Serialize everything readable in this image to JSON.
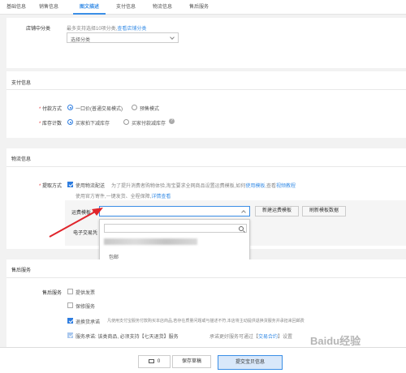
{
  "tabs": [
    {
      "label": "基础信息",
      "active": false
    },
    {
      "label": "销售信息",
      "active": false
    },
    {
      "label": "图文描述",
      "active": true
    },
    {
      "label": "支付信息",
      "active": false
    },
    {
      "label": "物流信息",
      "active": false
    },
    {
      "label": "售后服务",
      "active": false
    }
  ],
  "shop_category": {
    "label": "店铺中分类",
    "hint": "最多支持选择10项分类,",
    "link": "查看店铺分类",
    "select_value": "选择分类"
  },
  "payment": {
    "title": "支付信息",
    "method_label": "付款方式",
    "method_options": [
      "一口价(普通交易模式)",
      "预售模式"
    ],
    "stock_label": "库存计数",
    "stock_options": [
      "买家拍下减库存",
      "买家付款减库存"
    ]
  },
  "logistics": {
    "title": "物流信息",
    "pickup_label": "提取方式",
    "use_logistics": "使用物流配送",
    "hint1": "为了提升消费者购物体验,淘宝要求全网商品设置运费模板,如何",
    "hint_link1": "使用模板",
    "hint_mid": ",查看",
    "hint_link2": "视频教程",
    "hint2": "使用官方寄件,一键发货、全程保障,",
    "hint2_link": "详情查看",
    "template_label": "运费模板",
    "new_template_btn": "新建运费模板",
    "refresh_btn": "刷新模板数据",
    "ewaybill_label": "电子交易凭",
    "dropdown_item": "包邮"
  },
  "after_sales": {
    "title": "售后服务",
    "label": "售后服务",
    "options": [
      {
        "label": "提供发票",
        "checked": false
      },
      {
        "label": "保修服务",
        "checked": false
      },
      {
        "label": "退换货承诺",
        "checked": true
      },
      {
        "label": "服务承诺: 该类商品, 必须支持【七天退货】服务",
        "checked": true
      }
    ],
    "return_hint": "凡使用支付宝服务付款购买本店商品,若存在质量问题或与描述不符,本店将主动提供退换货服务并承担来回邮费",
    "service_hint": "承诺更好服务可通过【",
    "service_link": "交易合约",
    "service_tail": "】设置"
  },
  "footer": {
    "count": "0",
    "save_draft": "保存草稿",
    "submit": "提交宝贝信息"
  },
  "watermark": "Baidu经验",
  "colors": {
    "accent": "#3a8ee6",
    "arrow": "#e0242b"
  }
}
